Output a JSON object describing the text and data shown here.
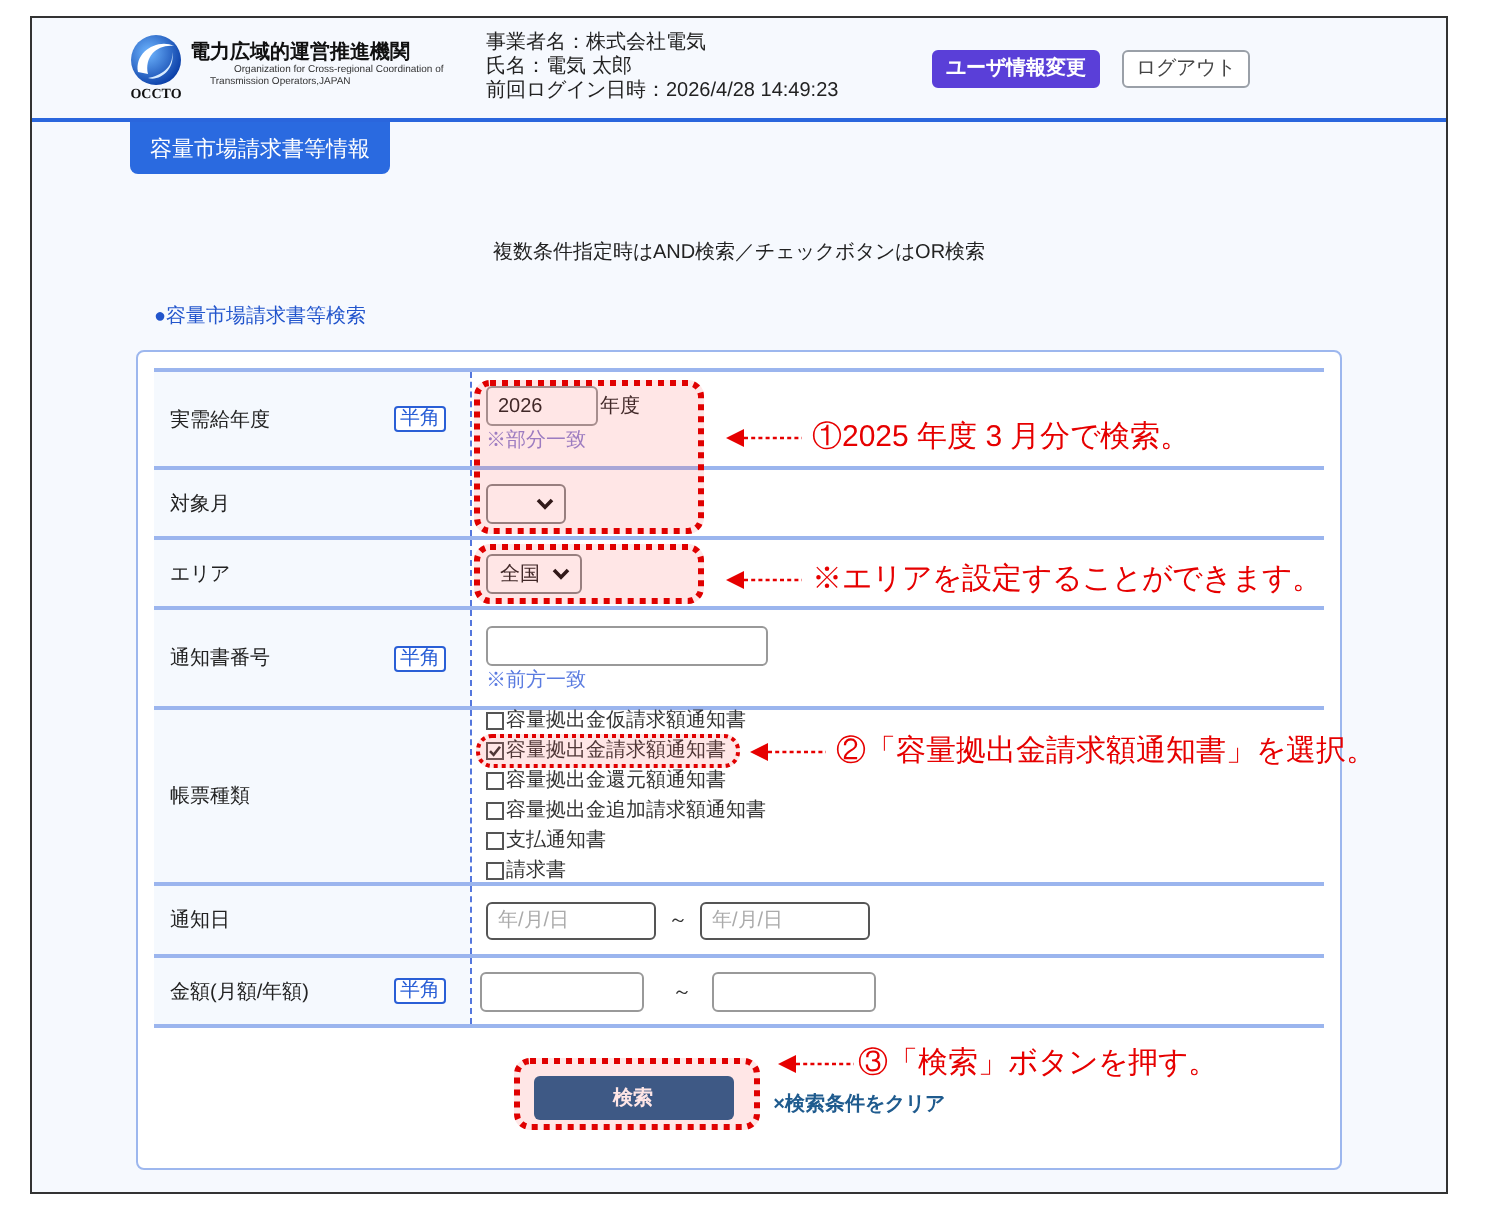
{
  "header": {
    "logo": {
      "name": "電力広域的運営推進機関",
      "subtitle": [
        "Organization for Cross-regional Coordination of",
        "Transmission Operators,JAPAN"
      ],
      "abbreviation": "OCCTO"
    },
    "user_info": [
      "事業者名：株式会社電気",
      "氏名：電気 太郎",
      "前回ログイン日時：2026/4/28 14:49:23"
    ],
    "buttons": [
      {
        "label": "ユーザ情報変更",
        "kind": "primary"
      },
      {
        "label": "ログアウト",
        "kind": "outline"
      }
    ]
  },
  "page_tab": "容量市場請求書等情報",
  "notice": "複数条件指定時はAND検索／チェックボタンはOR検索",
  "section_title": "●容量市場請求書等検索",
  "search_form": {
    "rows": [
      {
        "kind": "year",
        "label": "実需給年度",
        "badge": "半角",
        "value": "2026",
        "unit": "年度",
        "hint": "※部分一致"
      },
      {
        "kind": "select",
        "label": "対象月"
      },
      {
        "kind": "select",
        "label": "エリア",
        "value": "全国"
      },
      {
        "kind": "text",
        "label": "通知書番号",
        "badge": "半角",
        "hint": "※前方一致"
      },
      {
        "kind": "checkboxes",
        "label": "帳票種類",
        "options": [
          {
            "label": "容量拠出金仮請求額通知書",
            "checked": false
          },
          {
            "label": "容量拠出金請求額通知書",
            "checked": true
          },
          {
            "label": "容量拠出金還元額通知書",
            "checked": false
          },
          {
            "label": "容量拠出金追加請求額通知書",
            "checked": false
          },
          {
            "label": "支払通知書",
            "checked": false
          },
          {
            "label": "請求書",
            "checked": false
          }
        ]
      },
      {
        "kind": "date_range",
        "label": "通知日",
        "fields": [
          {
            "placeholder": "年/月/日"
          },
          {
            "placeholder": "年/月/日"
          }
        ],
        "separator": "～"
      },
      {
        "kind": "amount_range",
        "label": "金額(月額/年額)",
        "badge": "半角",
        "separator": "～"
      }
    ],
    "search_button": "検索",
    "clear_link": "×検索条件をクリア"
  },
  "annotations": [
    {
      "text": "①2025 年度 3 月分で検索。"
    },
    {
      "text": "※エリアを設定することができます。"
    },
    {
      "text": "②「容量拠出金請求額通知書」を選択。"
    },
    {
      "text": "③「検索」ボタンを押す。"
    }
  ]
}
